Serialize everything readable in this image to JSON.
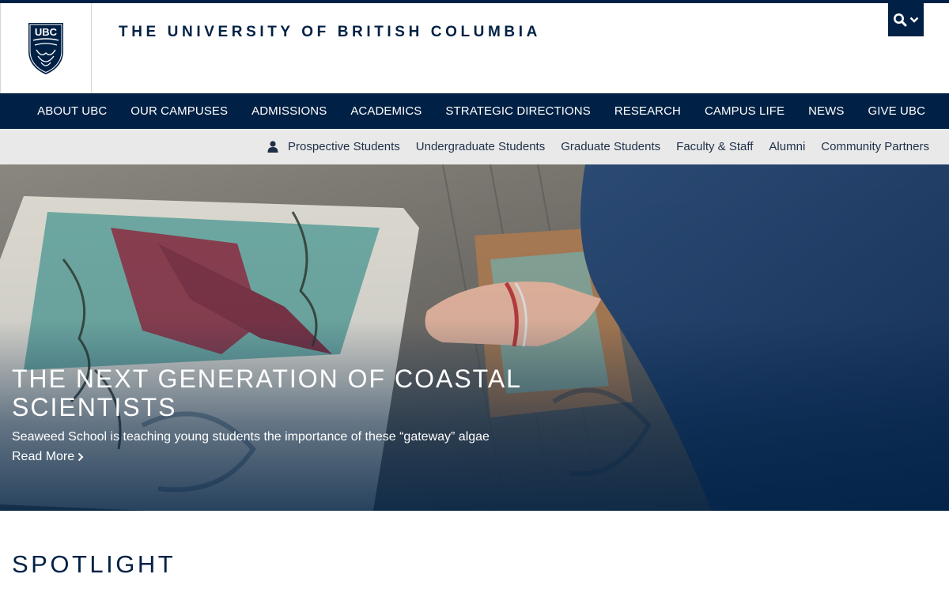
{
  "header": {
    "wordmark": "THE UNIVERSITY OF BRITISH COLUMBIA",
    "logo_text": "UBC",
    "search_icon": "search-icon",
    "search_toggle_icon": "chevron-down-icon"
  },
  "main_nav": {
    "items": [
      {
        "label": "ABOUT UBC"
      },
      {
        "label": "OUR CAMPUSES"
      },
      {
        "label": "ADMISSIONS"
      },
      {
        "label": "ACADEMICS"
      },
      {
        "label": "STRATEGIC DIRECTIONS"
      },
      {
        "label": "RESEARCH"
      },
      {
        "label": "CAMPUS LIFE"
      },
      {
        "label": "NEWS"
      },
      {
        "label": "GIVE UBC"
      }
    ]
  },
  "audience_nav": {
    "icon": "person-icon",
    "items": [
      {
        "label": "Prospective Students"
      },
      {
        "label": "Undergraduate Students"
      },
      {
        "label": "Graduate Students"
      },
      {
        "label": "Faculty & Staff"
      },
      {
        "label": "Alumni"
      },
      {
        "label": "Community Partners"
      }
    ]
  },
  "hero": {
    "title": "THE NEXT GENERATION OF COASTAL SCIENTISTS",
    "subtitle": "Seaweed School is teaching young students the importance of these “gateway” algae",
    "link_label": "Read More",
    "link_icon": "chevron-right-icon"
  },
  "spotlight": {
    "heading": "SPOTLIGHT"
  },
  "colors": {
    "brand_navy": "#002145",
    "audience_bar": "#e9e9e9",
    "white": "#ffffff"
  }
}
